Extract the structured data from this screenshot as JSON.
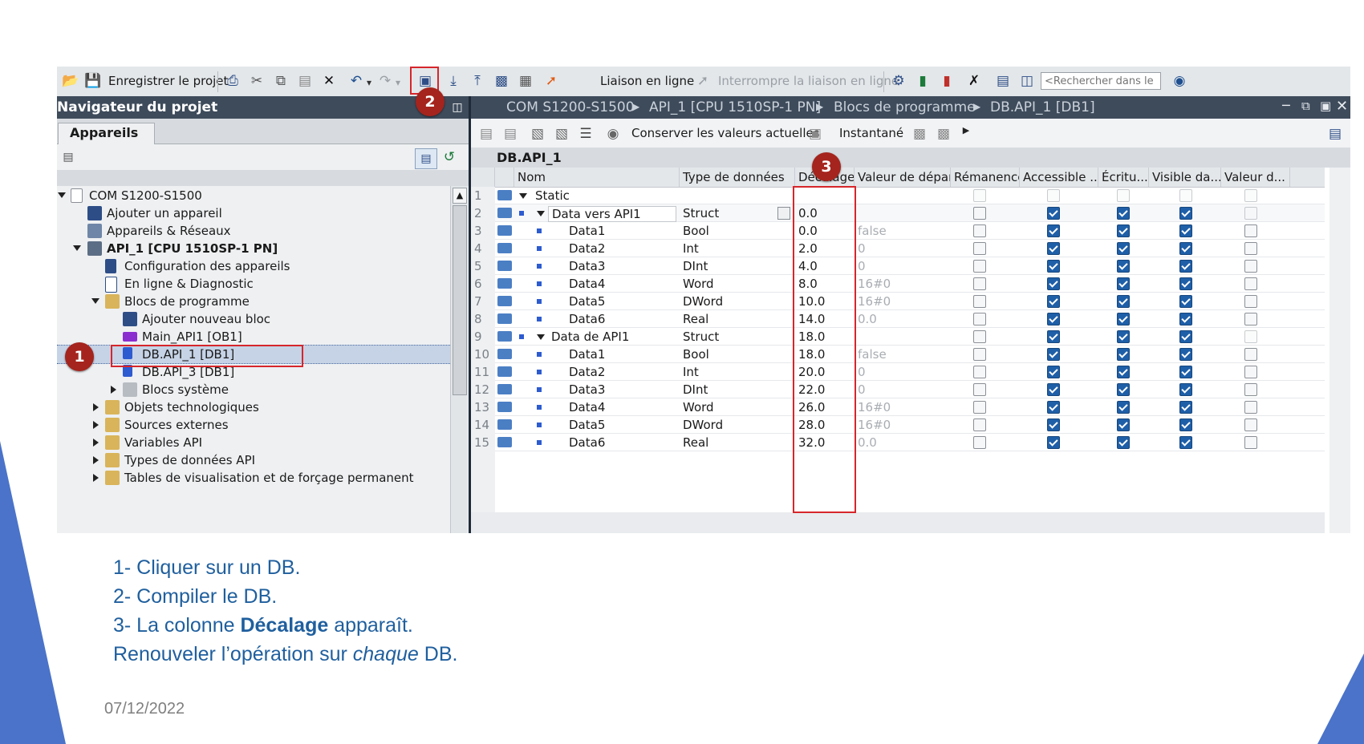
{
  "toolbar": {
    "save_label": "Enregistrer le projet",
    "go_online_label": "Liaison en ligne",
    "go_offline_label": "Interrompre la liaison en ligne",
    "search_placeholder": "<Rechercher dans le"
  },
  "navigator": {
    "title": "Navigateur du projet",
    "tab_label": "Appareils",
    "tree": [
      {
        "label": "COM S1200-S1500"
      },
      {
        "label": "Ajouter un appareil"
      },
      {
        "label": "Appareils & Réseaux"
      },
      {
        "label": "API_1 [CPU 1510SP-1 PN]"
      },
      {
        "label": "Configuration des appareils"
      },
      {
        "label": "En ligne & Diagnostic"
      },
      {
        "label": "Blocs de programme"
      },
      {
        "label": "Ajouter nouveau bloc"
      },
      {
        "label": "Main_API1 [OB1]"
      },
      {
        "label": "DB.API_1 [DB1]"
      },
      {
        "label": "DB.API_3 [DB1]"
      },
      {
        "label": "Blocs système"
      },
      {
        "label": "Objets technologiques"
      },
      {
        "label": "Sources externes"
      },
      {
        "label": "Variables API"
      },
      {
        "label": "Types de données API"
      },
      {
        "label": "Tables de visualisation et de forçage permanent"
      }
    ]
  },
  "breadcrumb": {
    "items": [
      "COM S1200-S1500",
      "API_1 [CPU 1510SP-1 PN]",
      "Blocs de programme",
      "DB.API_1 [DB1]"
    ]
  },
  "editor": {
    "keep_values_label": "Conserver les valeurs actuelles",
    "snapshot_label": "Instantané",
    "block_title": "DB.API_1",
    "columns": [
      "Nom",
      "Type de données",
      "Décalage",
      "Valeur de départ",
      "Rémanence",
      "Accessible ...",
      "Écritu...",
      "Visible da...",
      "Valeur d..."
    ],
    "rows": [
      {
        "num": "1",
        "name": "Static",
        "type": "",
        "offset": "",
        "start": ""
      },
      {
        "num": "2",
        "name": "Data vers API1",
        "type": "Struct",
        "offset": "0.0",
        "start": ""
      },
      {
        "num": "3",
        "name": "Data1",
        "type": "Bool",
        "offset": "0.0",
        "start": "false"
      },
      {
        "num": "4",
        "name": "Data2",
        "type": "Int",
        "offset": "2.0",
        "start": "0"
      },
      {
        "num": "5",
        "name": "Data3",
        "type": "DInt",
        "offset": "4.0",
        "start": "0"
      },
      {
        "num": "6",
        "name": "Data4",
        "type": "Word",
        "offset": "8.0",
        "start": "16#0"
      },
      {
        "num": "7",
        "name": "Data5",
        "type": "DWord",
        "offset": "10.0",
        "start": "16#0"
      },
      {
        "num": "8",
        "name": "Data6",
        "type": "Real",
        "offset": "14.0",
        "start": "0.0"
      },
      {
        "num": "9",
        "name": "Data de API1",
        "type": "Struct",
        "offset": "18.0",
        "start": ""
      },
      {
        "num": "10",
        "name": "Data1",
        "type": "Bool",
        "offset": "18.0",
        "start": "false"
      },
      {
        "num": "11",
        "name": "Data2",
        "type": "Int",
        "offset": "20.0",
        "start": "0"
      },
      {
        "num": "12",
        "name": "Data3",
        "type": "DInt",
        "offset": "22.0",
        "start": "0"
      },
      {
        "num": "13",
        "name": "Data4",
        "type": "Word",
        "offset": "26.0",
        "start": "16#0"
      },
      {
        "num": "14",
        "name": "Data5",
        "type": "DWord",
        "offset": "28.0",
        "start": "16#0"
      },
      {
        "num": "15",
        "name": "Data6",
        "type": "Real",
        "offset": "32.0",
        "start": "0.0"
      }
    ]
  },
  "callouts": [
    "1",
    "2",
    "3"
  ],
  "notes": {
    "line1": "1- Cliquer sur un DB.",
    "line2": "2- Compiler le DB.",
    "line3_pre": "3- La colonne ",
    "line3_bold": "Décalage",
    "line3_post": " apparaît.",
    "line4_pre": "Renouveler l’opération sur ",
    "line4_italic": "chaque",
    "line4_post": " DB."
  },
  "footer": {
    "date": "07/12/2022"
  },
  "colors": {
    "accent_blue": "#1f5fa8",
    "callout_red": "#a5241d",
    "highlight_red": "#d6262b",
    "slide_blue": "#4a73c9",
    "note_text": "#1f5f9e"
  }
}
